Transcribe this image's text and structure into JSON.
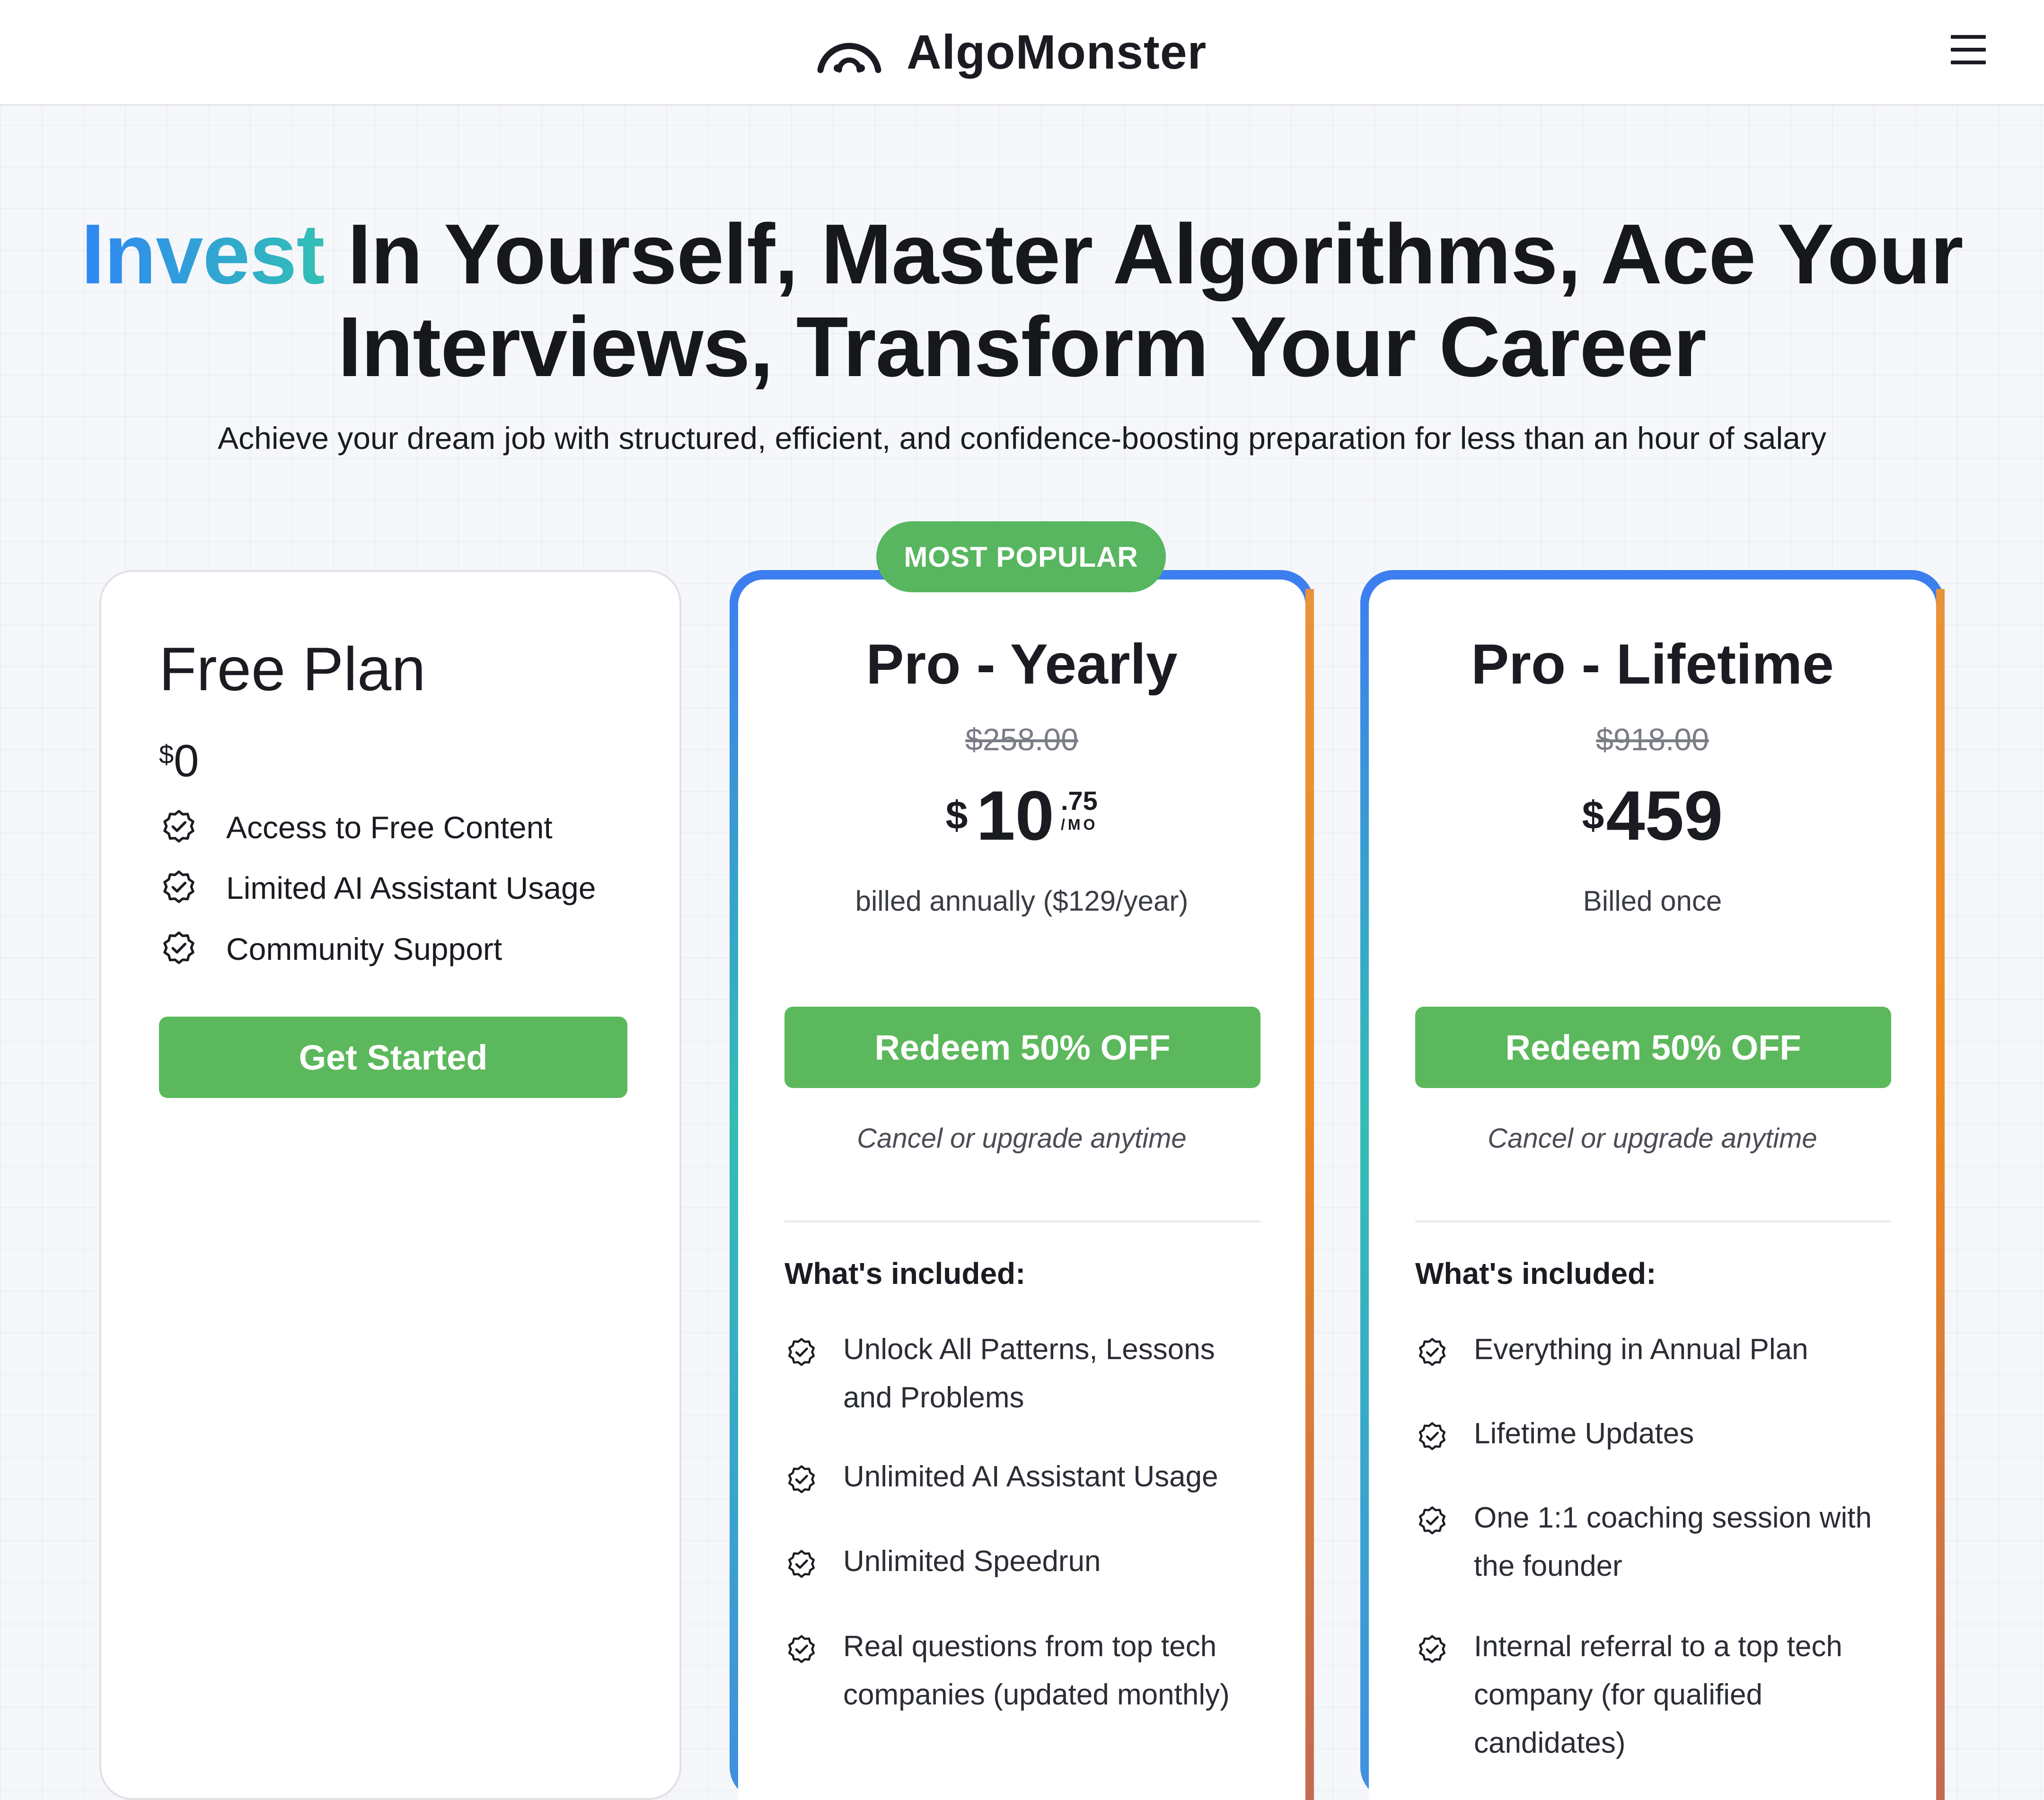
{
  "header": {
    "brand": "AlgoMonster",
    "menu_icon": "hamburger-menu-icon"
  },
  "hero": {
    "title_accent": "Invest",
    "title_line1_rest": " In Yourself, Master Algorithms, Ace Your",
    "title_line2": "Interviews, Transform Your Career",
    "subtitle": "Achieve your dream job with structured, efficient, and confidence-boosting preparation for less than an hour of salary"
  },
  "plans": {
    "free": {
      "title": "Free Plan",
      "currency": "$",
      "price": "0",
      "features": [
        "Access to Free Content",
        "Limited AI Assistant Usage",
        "Community Support"
      ],
      "cta": "Get Started"
    },
    "yearly": {
      "badge": "MOST POPULAR",
      "title": "Pro - Yearly",
      "original_price": "$258.00",
      "currency": "$",
      "price_whole": "10",
      "price_cents": ".75",
      "price_period": "/MO",
      "billing_note": "billed annually ($129/year)",
      "cta": "Redeem 50% OFF",
      "cancel_note": "Cancel or upgrade anytime",
      "included_heading": "What's included:",
      "included": [
        "Unlock All Patterns, Lessons and Problems",
        "Unlimited AI Assistant Usage",
        "Unlimited Speedrun",
        "Real questions from top tech companies (updated monthly)"
      ]
    },
    "lifetime": {
      "title": "Pro - Lifetime",
      "original_price": "$918.00",
      "currency": "$",
      "price": "459",
      "billing_note": "Billed once",
      "cta": "Redeem 50% OFF",
      "cancel_note": "Cancel or upgrade anytime",
      "included_heading": "What's included:",
      "included": [
        "Everything in Annual Plan",
        "Lifetime Updates",
        "One 1:1 coaching session with the founder",
        "Internal referral to a top tech company (for qualified candidates)"
      ]
    }
  },
  "colors": {
    "accent_green": "#5cb85c",
    "gradient_blue": "#2f86f5",
    "gradient_teal": "#32c0b4",
    "gradient_orange": "#f08a22"
  }
}
